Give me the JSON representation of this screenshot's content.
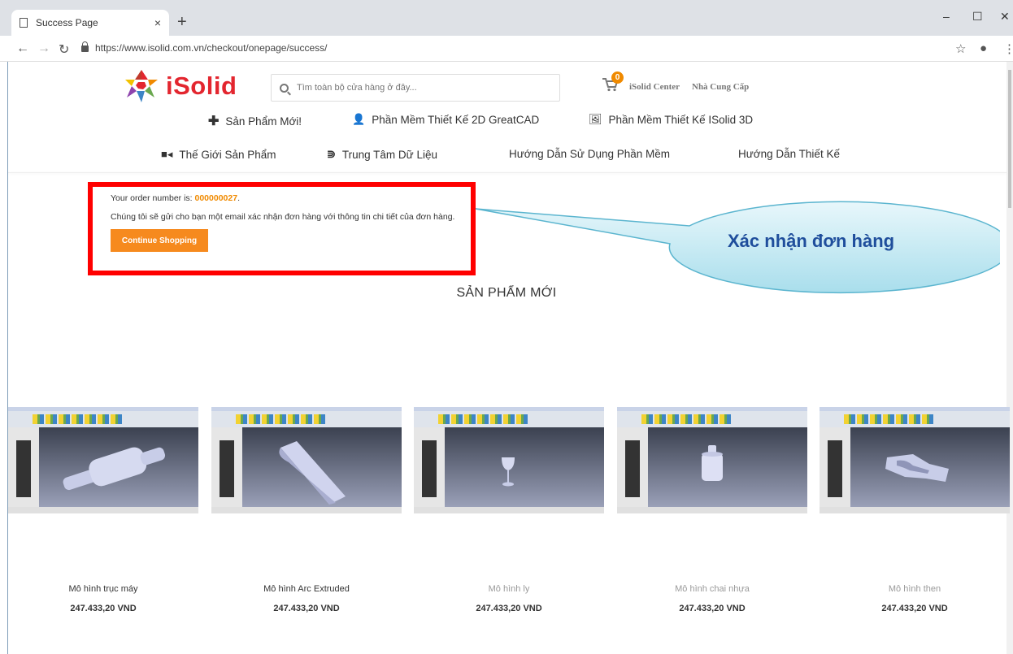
{
  "browser": {
    "tab_title": "Success Page",
    "tab_close": "×",
    "new_tab": "+",
    "url": "https://www.isolid.com.vn/checkout/onepage/success/",
    "min": "–",
    "max": "☐",
    "close": "✕"
  },
  "header": {
    "logo_text": "iSolid",
    "search_placeholder": "Tìm toàn bộ cửa hàng ở đây...",
    "cart_count": "0",
    "link_center": "iSolid Center",
    "link_supplier": "Nhà Cung Cấp"
  },
  "menu": {
    "row1": [
      "Sản Phẩm Mới!",
      "Phần Mềm Thiết Kế 2D GreatCAD",
      "Phần Mềm Thiết Kế ISolid 3D"
    ],
    "row2": [
      "Thế Giới Sản Phẩm",
      "Trung Tâm Dữ Liệu",
      "Hướng Dẫn Sử Dụng Phần Mềm",
      "Hướng Dẫn Thiết Kế"
    ]
  },
  "success": {
    "order_label": "Your order number is: ",
    "order_number": "000000027",
    "order_suffix": ".",
    "email_text": "Chúng tôi sẽ gửi cho bạn một email xác nhận đơn hàng với thông tin chi tiết của đơn hàng.",
    "continue_label": "Continue Shopping"
  },
  "callout": {
    "text": "Xác nhận đơn hàng"
  },
  "section_title": "SẢN PHẨM MỚI",
  "products": [
    {
      "name": "Mô hình trục máy",
      "price": "247.433,20 VND"
    },
    {
      "name": "Mô hình Arc Extruded",
      "price": "247.433,20 VND"
    },
    {
      "name": "Mô hình ly",
      "price": "247.433,20 VND"
    },
    {
      "name": "Mô hình chai nhựa",
      "price": "247.433,20 VND"
    },
    {
      "name": "Mô hình then",
      "price": "247.433,20 VND"
    }
  ],
  "colors": {
    "brand_red": "#e3262f",
    "accent_orange": "#f68a1e",
    "highlight_red": "#ff0000",
    "callout_blue": "#1f4e9c"
  }
}
